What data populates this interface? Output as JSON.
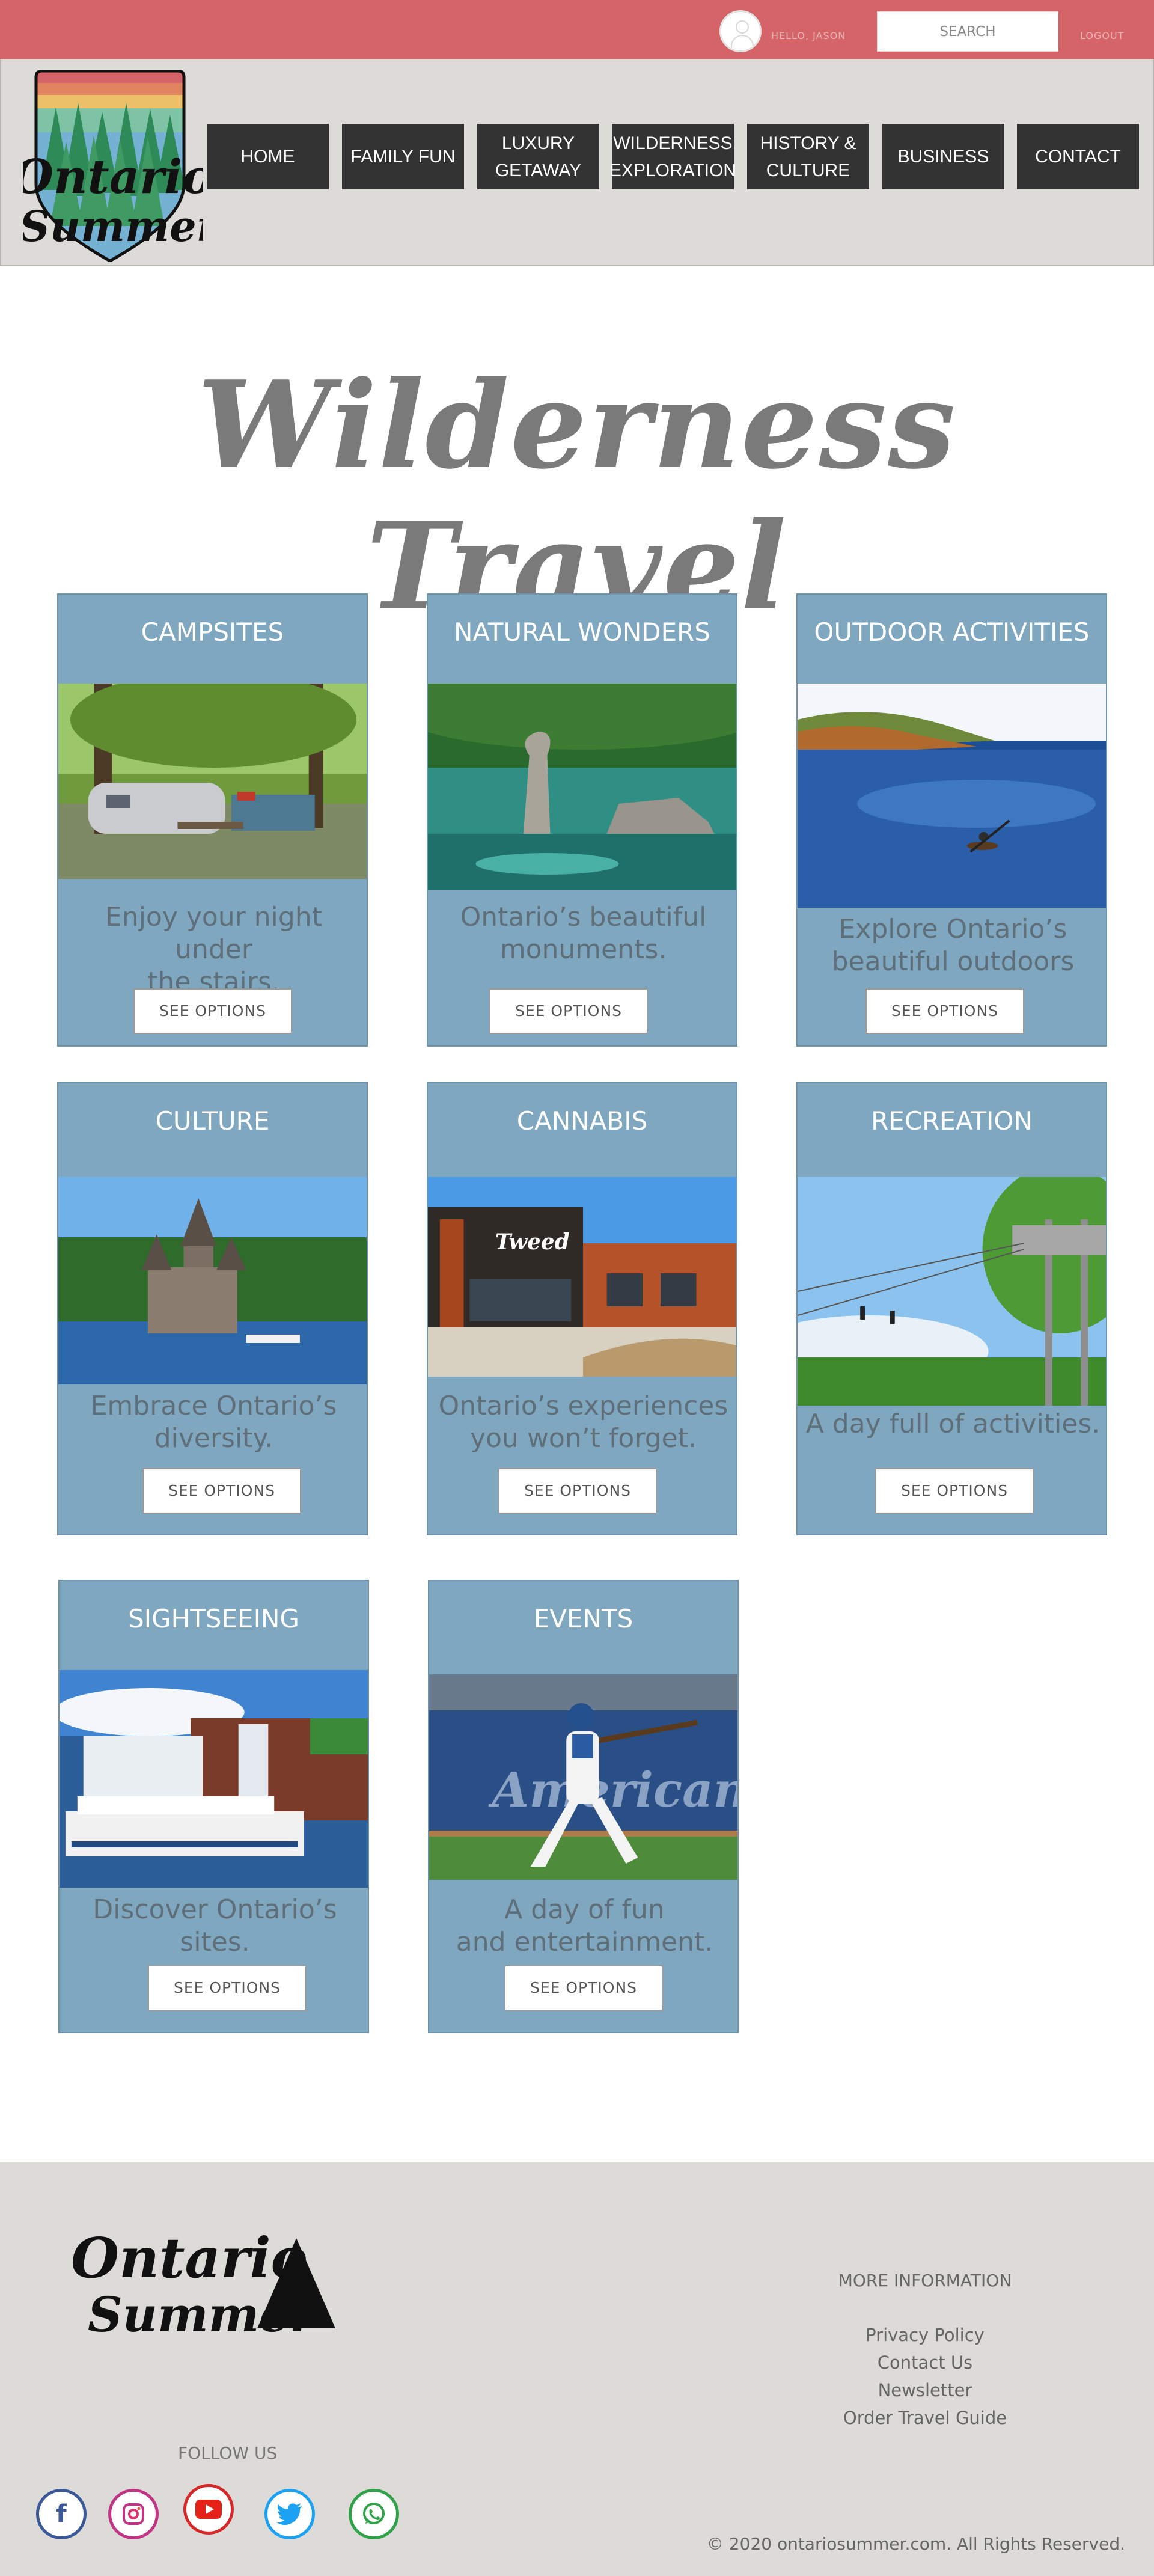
{
  "topbar": {
    "greeting": "HELLO, JASON",
    "search_label": "SEARCH",
    "logout_label": "LOGOUT",
    "color": "#d46468"
  },
  "brand": {
    "line1": "Ontario",
    "line2": "Summer"
  },
  "nav": [
    {
      "label": "HOME"
    },
    {
      "label": "FAMILY FUN"
    },
    {
      "label": "LUXURY\nGETAWAY"
    },
    {
      "label": "WILDERNESS\nEXPLORATION"
    },
    {
      "label": "HISTORY &\nCULTURE"
    },
    {
      "label": "BUSINESS"
    },
    {
      "label": "CONTACT"
    }
  ],
  "page_title": "Wilderness Travel",
  "cards": [
    {
      "title": "CAMPSITES",
      "description": "Enjoy your night under\nthe stairs.",
      "button": "SEE OPTIONS",
      "image": "campsite-photo"
    },
    {
      "title": "NATURAL WONDERS",
      "description": "Ontario’s beautiful\nmonuments.",
      "button": "SEE OPTIONS",
      "image": "flowerpot-rock-photo"
    },
    {
      "title": "OUTDOOR ACTIVITIES",
      "description": "Explore Ontario’s\nbeautiful outdoors",
      "button": "SEE OPTIONS",
      "image": "lake-kayak-photo"
    },
    {
      "title": "CULTURE",
      "description": "Embrace Ontario’s\ndiversity.",
      "button": "SEE OPTIONS",
      "image": "castle-photo"
    },
    {
      "title": "CANNABIS",
      "description": "Ontario’s experiences\nyou won’t forget.",
      "button": "SEE OPTIONS",
      "image": "tweed-store-photo",
      "sign_text": "Tweed"
    },
    {
      "title": "RECREATION",
      "description": "A day full of activities.",
      "button": "SEE OPTIONS",
      "image": "zipline-photo"
    },
    {
      "title": "SIGHTSEEING",
      "description": "Discover Ontario’s sites.",
      "button": "SEE OPTIONS",
      "image": "niagara-boat-photo"
    },
    {
      "title": "EVENTS",
      "description": "A day of fun\nand entertainment.",
      "button": "SEE OPTIONS",
      "image": "baseball-photo",
      "banner_text": "American"
    }
  ],
  "footer": {
    "follow_label": "FOLLOW US",
    "social": [
      "facebook-icon",
      "instagram-icon",
      "youtube-icon",
      "twitter-icon",
      "whatsapp-icon"
    ],
    "more_info_label": "MORE INFORMATION",
    "links": [
      "Privacy Policy",
      "Contact Us",
      "Newsletter",
      "Order Travel Guide"
    ],
    "copyright": "© 2020 ontariosummer.com. All Rights Reserved."
  },
  "colors": {
    "card": "#7fa7c0",
    "header_bg": "#dddbd8",
    "nav_bg": "#333333",
    "topbar": "#d46468"
  }
}
